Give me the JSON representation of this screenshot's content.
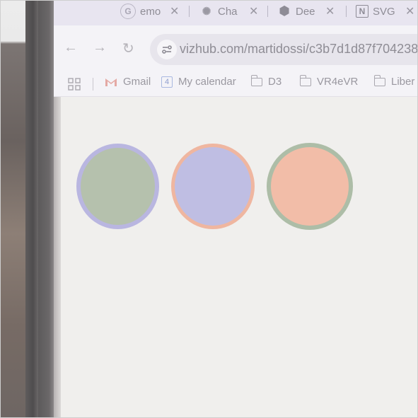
{
  "tabs": [
    {
      "title": "emo",
      "favicon": "google-g-icon",
      "close": "✕"
    },
    {
      "title": "Cha",
      "favicon": "openai-icon",
      "close": "✕"
    },
    {
      "title": "Dee",
      "favicon": "deepl-icon",
      "close": "✕"
    },
    {
      "title": "SVG",
      "favicon": "notion-icon",
      "close": "✕"
    }
  ],
  "toolbar": {
    "back": "←",
    "forward": "→",
    "reload": "↻",
    "url": "vizhub.com/martidossi/c3b7d1d87f704238"
  },
  "bookmarks": [
    {
      "label": "Gmail",
      "icon": "gmail-icon"
    },
    {
      "label": "My calendar",
      "icon": "calendar-icon",
      "icon_text": "4"
    },
    {
      "label": "D3",
      "icon": "folder-icon"
    },
    {
      "label": "VR4eVR",
      "icon": "folder-icon"
    },
    {
      "label": "Liber",
      "icon": "folder-icon"
    }
  ],
  "content": {
    "circles": [
      {
        "fill": "#b5c1ad",
        "stroke": "#b9b6e0"
      },
      {
        "fill": "#bfbee3",
        "stroke": "#efb6a0"
      },
      {
        "fill": "#f2bda8",
        "stroke": "#adbda7"
      }
    ]
  },
  "colors": {
    "tab_strip": "#e8e5f0",
    "toolbar": "#f4f3f7",
    "page_background": "#f0efed"
  }
}
